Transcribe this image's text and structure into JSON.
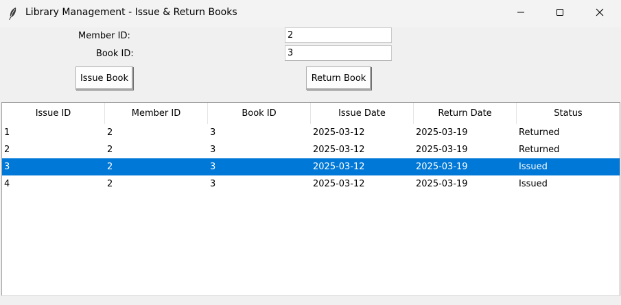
{
  "window": {
    "title": "Library Management - Issue & Return Books",
    "icon": "feather-icon",
    "controls": [
      "minimize-icon",
      "maximize-icon",
      "close-icon"
    ]
  },
  "form": {
    "member_label": "Member ID:",
    "member_value": "2",
    "book_label": "Book ID:",
    "book_value": "3"
  },
  "buttons": {
    "issue_label": "Issue Book",
    "return_label": "Return Book"
  },
  "table": {
    "columns": [
      "Issue ID",
      "Member ID",
      "Book ID",
      "Issue Date",
      "Return Date",
      "Status"
    ],
    "rows": [
      {
        "cells": [
          "1",
          "2",
          "3",
          "2025-03-12",
          "2025-03-19",
          "Returned"
        ],
        "selected": false
      },
      {
        "cells": [
          "2",
          "2",
          "3",
          "2025-03-12",
          "2025-03-19",
          "Returned"
        ],
        "selected": false
      },
      {
        "cells": [
          "3",
          "2",
          "3",
          "2025-03-12",
          "2025-03-19",
          "Issued"
        ],
        "selected": true
      },
      {
        "cells": [
          "4",
          "2",
          "3",
          "2025-03-12",
          "2025-03-19",
          "Issued"
        ],
        "selected": false
      }
    ],
    "selection_color": "#0078d7"
  }
}
